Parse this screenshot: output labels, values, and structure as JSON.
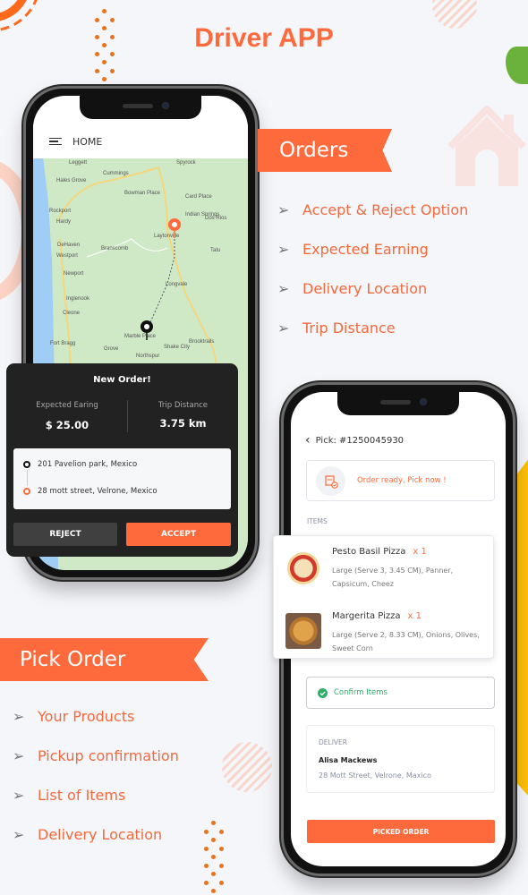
{
  "title": "Driver APP",
  "orders_section": {
    "banner": "Orders",
    "features": [
      "Accept & Reject Option",
      "Expected Earning",
      "Delivery Location",
      "Trip Distance"
    ]
  },
  "pick_section": {
    "banner": "Pick Order",
    "features": [
      "Your Products",
      "Pickup confirmation",
      "List of Items",
      "Delivery Location"
    ]
  },
  "home_screen": {
    "header_title": "HOME",
    "map_labels": [
      "Leggett",
      "Cummings",
      "Hales Grove",
      "Bowman Place",
      "Card Place",
      "Rockport",
      "Hardy",
      "Indian Springs",
      "Dos Rios",
      "Laytonville",
      "DeHaven",
      "Branscomb",
      "Westport",
      "Tatu",
      "Newport",
      "Longvale",
      "Inglenook",
      "Cleone",
      "Marble Place",
      "Fort Bragg",
      "Grove",
      "Shake City",
      "Brooktrails",
      "Northspur",
      "Spyrock"
    ],
    "new_order": {
      "title": "New Order!",
      "earning_label": "Expected Earing",
      "earning_value": "$ 25.00",
      "distance_label": "Trip Distance",
      "distance_value": "3.75 km",
      "pickup_address": "201 Pavelion park, Mexico",
      "drop_address": "28 mott street, Velrone, Mexico",
      "reject_label": "REJECT",
      "accept_label": "ACCEPT"
    }
  },
  "pick_screen": {
    "header_title": "Pick: #1250045930",
    "status_text": "Order ready, Pick now !",
    "items_label": "ITEMS",
    "items": [
      {
        "name": "Pesto Basil Pizza",
        "qty": "x 1",
        "desc": "Large (Serve 3, 3.45 CM), Panner, Capsicum, Cheez"
      },
      {
        "name": "Margerita Pizza",
        "qty": "x 1",
        "desc": "Large (Serve 2, 8.33 CM), Onions, Olives, Sweet Corn"
      }
    ],
    "confirm_label": "Confirm Items",
    "deliver_label": "DELIVER",
    "customer_name": "Alisa Mackews",
    "customer_address": "28 Mott Street, Velrone, Maxico",
    "picked_button": "PICKED ORDER"
  },
  "colors": {
    "accent": "#ff6a3d",
    "success": "#2fae6a",
    "dark": "#222222",
    "yellow": "#ffc107"
  }
}
